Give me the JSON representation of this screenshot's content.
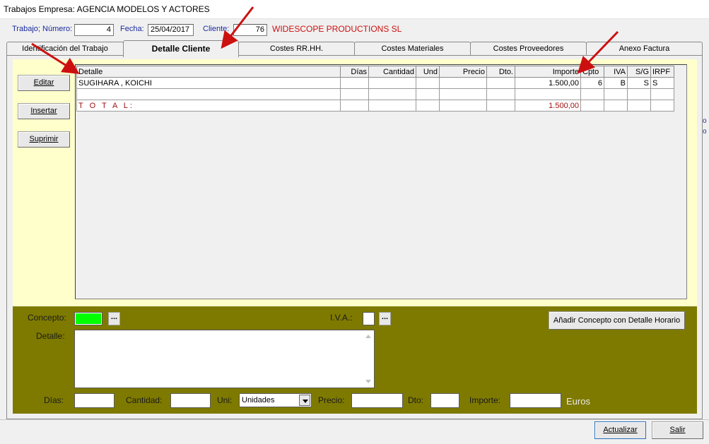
{
  "window": {
    "title": "Trabajos Empresa: AGENCIA MODELOS Y ACTORES"
  },
  "header": {
    "trabajo_label": "Trabajo; Número:",
    "trabajo_value": "4",
    "fecha_label": "Fecha:",
    "fecha_value": "25/04/2017",
    "cliente_label": "Cliente:",
    "cliente_value": "76",
    "cliente_name": "WIDESCOPE PRODUCTIONS SL"
  },
  "tabs": [
    {
      "label": "Identificación del Trabajo",
      "active": false
    },
    {
      "label": "Detalle Cliente",
      "active": true
    },
    {
      "label": "Costes RR.HH.",
      "active": false
    },
    {
      "label": "Costes Materiales",
      "active": false
    },
    {
      "label": "Costes Proveedores",
      "active": false
    },
    {
      "label": "Anexo Factura",
      "active": false
    }
  ],
  "side_buttons": {
    "editar": "Editar",
    "insertar": "Insertar",
    "suprimir": "Suprimir"
  },
  "grid": {
    "columns": [
      "Detalle",
      "Días",
      "Cantidad",
      "Und",
      "Precio",
      "Dto.",
      "Importe",
      "Cpto",
      "IVA",
      "S/G",
      "IRPF"
    ],
    "rows": [
      [
        "SUGIHARA , KOICHI",
        "",
        "",
        "",
        "",
        "",
        "1.500,00",
        "6",
        "B",
        "S",
        "S"
      ],
      [
        "",
        "",
        "",
        "",
        "",
        "",
        "",
        "",
        "",
        "",
        ""
      ]
    ],
    "total_label": "T O T A L:",
    "total_value": "1.500,00"
  },
  "form": {
    "concepto_label": "Concepto:",
    "iva_label": "I.V.A.:",
    "browse_label": "...",
    "add_concept_button": "Añadir Concepto con Detalle Horario",
    "detalle_label": "Detalle:",
    "dias_label": "Días:",
    "cantidad_label": "Cantidad:",
    "uni_label": "Uni:",
    "uni_value": "Unidades",
    "precio_label": "Precio:",
    "dto_label": "Dto:",
    "importe_label": "Importe:",
    "euros_label": "Euros"
  },
  "footer": {
    "actualizar": "Actualizar",
    "salir": "Salir"
  },
  "colors": {
    "concepto_field": "#00ff00",
    "olive_panel": "#7e7a00",
    "yellow_panel": "#ffffcc",
    "client_name": "#cc1010",
    "arrow": "#cc1010"
  }
}
